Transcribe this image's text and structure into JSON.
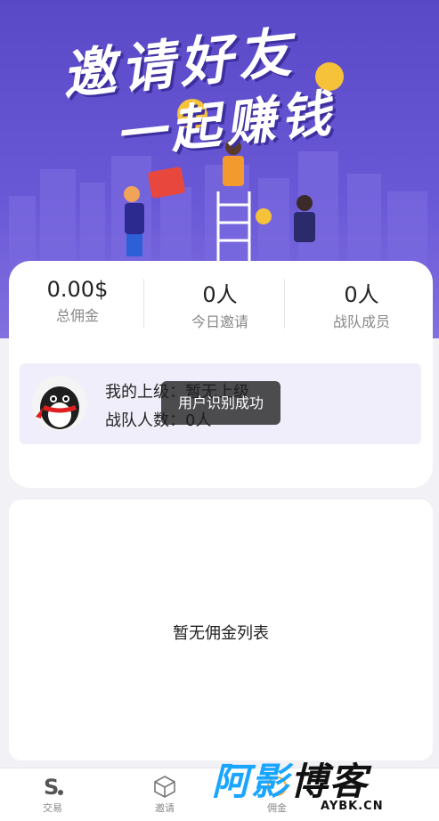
{
  "banner": {
    "line1": "邀请好友",
    "line2": "一起赚钱",
    "coin_symbol": "¥"
  },
  "stats": [
    {
      "value": "0.00$",
      "label": "总佣金"
    },
    {
      "value": "0人",
      "label": "今日邀请"
    },
    {
      "value": "0人",
      "label": "战队成员"
    }
  ],
  "upline": {
    "superior": "我的上级：暂无上级",
    "team_count": "战队人数：0人"
  },
  "toast": "用户识别成功",
  "commission_list": {
    "empty_text": "暂无佣金列表"
  },
  "tabbar": {
    "items": [
      {
        "label": "交易",
        "icon": "s-logo-icon"
      },
      {
        "label": "邀请",
        "icon": "cube-icon"
      },
      {
        "label": "佣金",
        "icon": "coin-icon"
      }
    ]
  },
  "watermark": {
    "title_blue": "阿影",
    "title_dark": "博客",
    "domain": "AYBK.CN"
  }
}
